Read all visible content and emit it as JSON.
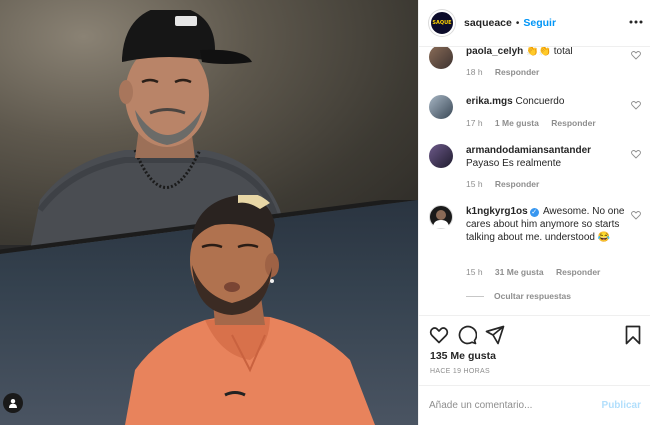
{
  "post": {
    "username": "saqueace",
    "separator": "•",
    "follow_label": "Seguir",
    "more_icon": "more-dots-icon",
    "avatar_text": "SAQUE"
  },
  "comments": [
    {
      "username": "paola_celyh",
      "text": "👏👏 total",
      "time": "18 h",
      "likes": "",
      "reply": "Responder"
    },
    {
      "username": "erika.mgs",
      "text": "Concuerdo",
      "time": "17 h",
      "likes": "1 Me gusta",
      "reply": "Responder"
    },
    {
      "username": "armandodamiansantander",
      "text": "Payaso Es realmente",
      "time": "15 h",
      "likes": "",
      "reply": "Responder"
    },
    {
      "username": "k1ngkyrg1os",
      "text": "Awesome. No one cares about him anymore so starts talking about me. understood 😂",
      "time": "15 h",
      "likes": "31 Me gusta",
      "reply": "Responder",
      "verified": "✓"
    }
  ],
  "hide_replies": "Ocultar respuestas",
  "actions": {
    "likes": "135 Me gusta",
    "ago": "HACE 19 HORAS"
  },
  "add_comment": {
    "placeholder": "Añade un comentario...",
    "post_label": "Publicar"
  },
  "colors": {
    "accent": "#0095f6",
    "muted": "#8e8e8e",
    "publish_disabled": "#b2dffc"
  }
}
